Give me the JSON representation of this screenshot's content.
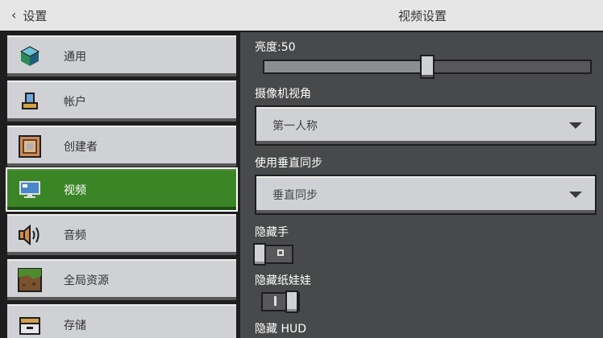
{
  "header": {
    "back_label": "设置",
    "title": "视频设置"
  },
  "sidebar": {
    "items": [
      {
        "label": "通用",
        "icon": "cube-icon"
      },
      {
        "label": "帐户",
        "icon": "person-icon"
      },
      {
        "label": "创建者",
        "icon": "command-block-icon"
      },
      {
        "label": "视频",
        "icon": "monitor-icon",
        "active": true
      },
      {
        "label": "音频",
        "icon": "speaker-icon"
      },
      {
        "label": "全局资源",
        "icon": "grass-block-icon"
      },
      {
        "label": "存储",
        "icon": "storage-icon"
      }
    ]
  },
  "settings": {
    "brightness": {
      "label": "亮度:50",
      "value": 50,
      "max": 100
    },
    "camera": {
      "label": "摄像机视角",
      "value": "第一人称"
    },
    "vsync": {
      "label": "使用垂直同步",
      "value": "垂直同步"
    },
    "hide_hand": {
      "label": "隐藏手",
      "on": false
    },
    "hide_paperdoll": {
      "label": "隐藏纸娃娃",
      "on": true
    },
    "hide_hud": {
      "label": "隐藏 HUD"
    }
  },
  "colors": {
    "active_green": "#3c8527",
    "button_gray": "#d0d1d4",
    "panel_gray": "#48494a"
  }
}
